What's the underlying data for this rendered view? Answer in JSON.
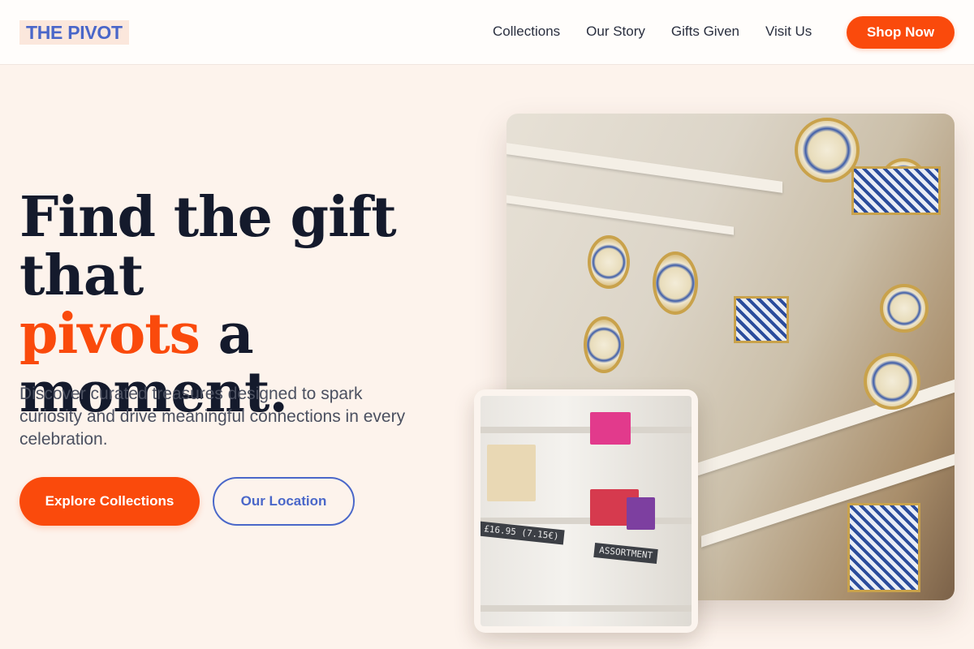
{
  "brand": {
    "logo_text": "THE PIVOT"
  },
  "nav": {
    "links": [
      "Collections",
      "Our Story",
      "Gifts Given",
      "Visit Us"
    ],
    "cta_label": "Shop Now"
  },
  "hero": {
    "headline_part1": "Find the gift that",
    "headline_accent": "pivots",
    "headline_part2": "a",
    "headline_part3": "moment.",
    "subtext": "Discover curated treasures designed to spark curiosity and drive meaningful connections in every celebration.",
    "primary_button": "Explore Collections",
    "secondary_button": "Our Location"
  },
  "images": {
    "main_alt": "Shop shelves with hand-painted ceramic plates and tiles",
    "inset_alt": "Gift shop shelves with boxes and chalk price labels",
    "inset_price_label": "£16.95 (7.15€)",
    "inset_assortment_label": "ASSORTMENT"
  },
  "colors": {
    "accent": "#fa4a0c",
    "brand_blue": "#4a67c9",
    "background": "#fdf3ec",
    "heading": "#141a2c"
  }
}
